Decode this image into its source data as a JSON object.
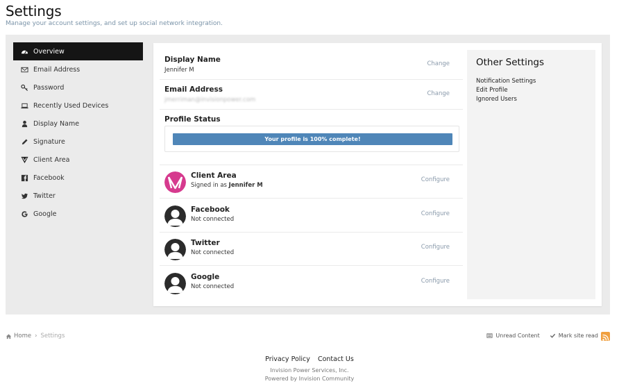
{
  "header": {
    "title": "Settings",
    "subtitle": "Manage your account settings, and set up social network integration."
  },
  "sidebar": {
    "items": [
      {
        "label": "Overview",
        "icon": "dashboard-icon",
        "active": true
      },
      {
        "label": "Email Address",
        "icon": "envelope-icon"
      },
      {
        "label": "Password",
        "icon": "key-icon"
      },
      {
        "label": "Recently Used Devices",
        "icon": "laptop-icon"
      },
      {
        "label": "Display Name",
        "icon": "user-icon"
      },
      {
        "label": "Signature",
        "icon": "pencil-icon"
      },
      {
        "label": "Client Area",
        "icon": "client-area-logo-icon"
      },
      {
        "label": "Facebook",
        "icon": "facebook-icon"
      },
      {
        "label": "Twitter",
        "icon": "twitter-icon"
      },
      {
        "label": "Google",
        "icon": "google-icon"
      }
    ]
  },
  "account": {
    "display_name": {
      "title": "Display Name",
      "value": "Jennifer M",
      "action": "Change"
    },
    "email": {
      "title": "Email Address",
      "value": "jmerriman@invisionpower.com",
      "action": "Change"
    },
    "profile_status": {
      "title": "Profile Status",
      "progress_text": "Your profile is 100% complete!",
      "progress_percent": 100
    }
  },
  "social": [
    {
      "name": "Client Area",
      "status_prefix": "Signed in as ",
      "status_user": "Jennifer M",
      "status": "",
      "action": "Configure",
      "avatar": "client-area-logo"
    },
    {
      "name": "Facebook",
      "status_prefix": "",
      "status_user": "",
      "status": "Not connected",
      "action": "Configure",
      "avatar": "default-avatar"
    },
    {
      "name": "Twitter",
      "status_prefix": "",
      "status_user": "",
      "status": "Not connected",
      "action": "Configure",
      "avatar": "default-avatar"
    },
    {
      "name": "Google",
      "status_prefix": "",
      "status_user": "",
      "status": "Not connected",
      "action": "Configure",
      "avatar": "default-avatar"
    }
  ],
  "other_settings": {
    "title": "Other Settings",
    "links": [
      "Notification Settings",
      "Edit Profile",
      "Ignored Users"
    ]
  },
  "breadcrumb": {
    "home": "Home",
    "current": "Settings"
  },
  "footer": {
    "unread": "Unread Content",
    "mark_read": "Mark site read",
    "links": [
      "Privacy Policy",
      "Contact Us"
    ],
    "company": "Invision Power Services, Inc.",
    "powered": "Powered by Invision Community"
  },
  "colors": {
    "active_nav_bg": "#151515",
    "progress_fill": "#4f86b8",
    "client_area_brand": "#d63a8e",
    "rss": "#f0a040"
  }
}
